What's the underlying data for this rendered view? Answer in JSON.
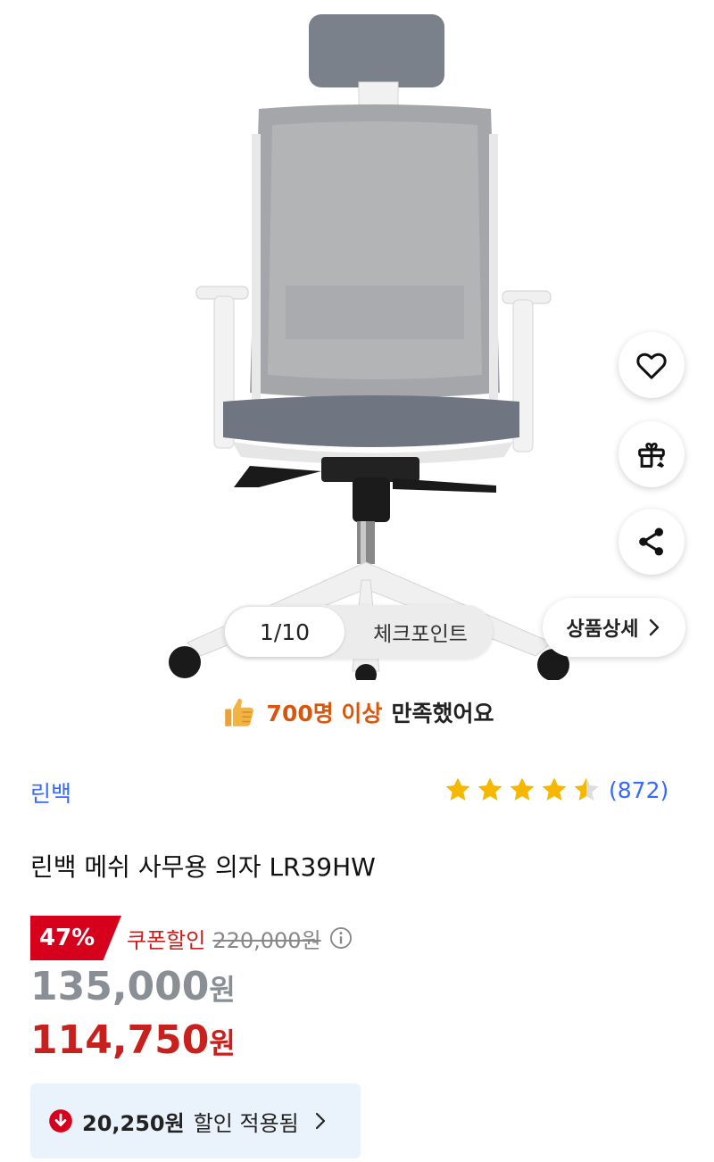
{
  "gallery": {
    "pager_count": "1/10",
    "checkpoint_label": "체크포인트",
    "detail_label": "상품상세"
  },
  "satisfaction": {
    "highlight": "700명 이상",
    "rest": "만족했어요"
  },
  "product": {
    "brand": "린백",
    "title": "린백 메쉬 사무용 의자 LR39HW",
    "rating_value": 4.5,
    "rating_max": 5,
    "review_count": "(872)"
  },
  "pricing": {
    "discount_percent": "47%",
    "coupon_label": "쿠폰할인",
    "original_price": "220,000원",
    "sale_price_number": "135,000",
    "coupon_price_number": "114,750",
    "won_unit": "원",
    "applied_amount": "20,250원",
    "applied_text": "할인 적용됨"
  },
  "colors": {
    "accent_blue": "#346aff",
    "discount_red": "#d6001c",
    "price_red": "#c8201c",
    "highlight_orange": "#d9560f",
    "star_yellow": "#f5b700"
  },
  "icons": [
    "heart-icon",
    "gift-icon",
    "share-icon",
    "chevron-right-icon",
    "thumbs-up-icon",
    "star-icon",
    "info-icon",
    "arrow-down-circle-icon"
  ]
}
